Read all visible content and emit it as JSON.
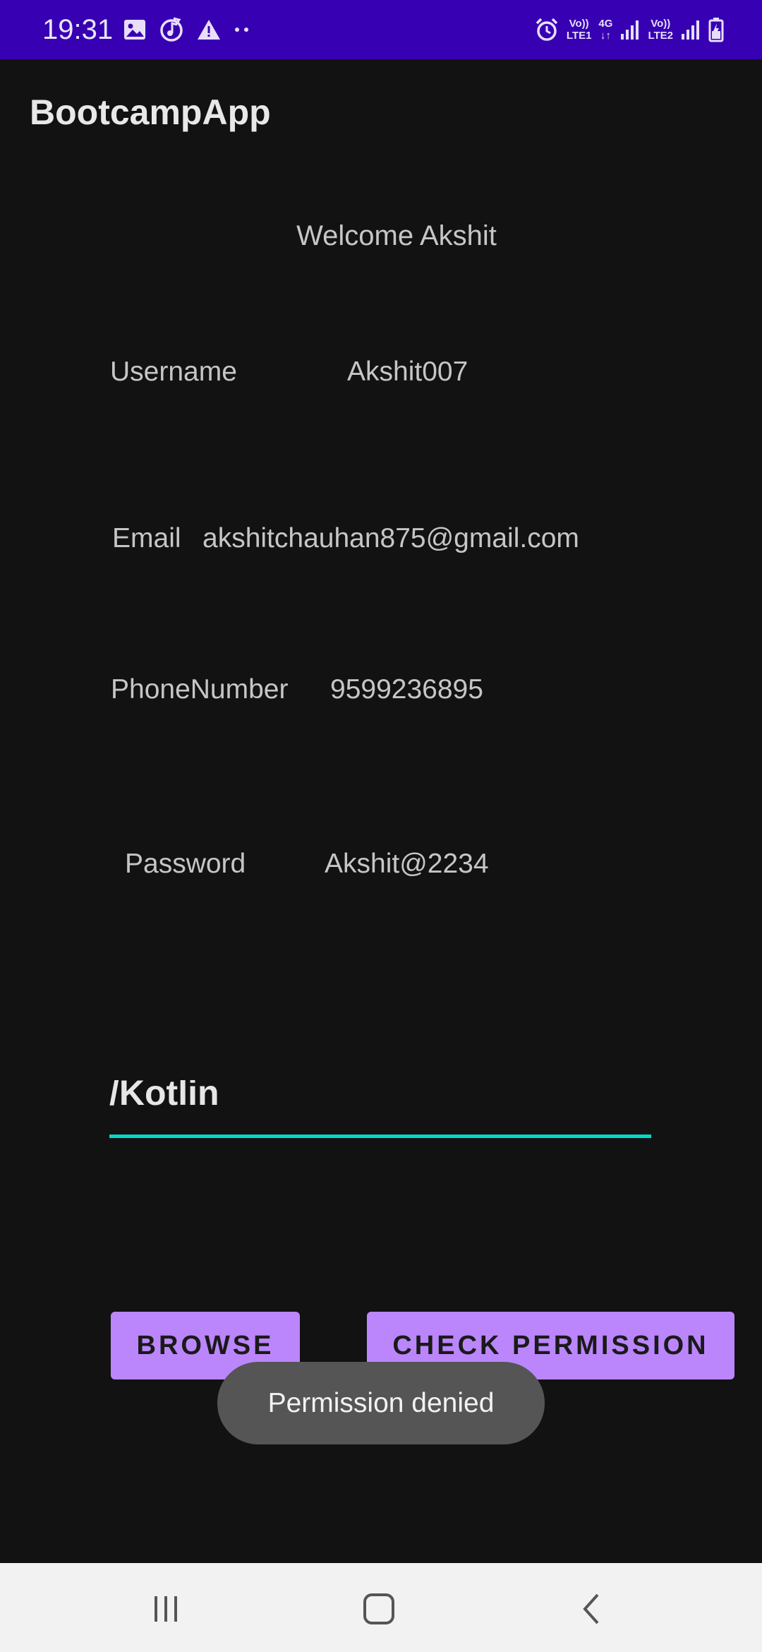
{
  "status_bar": {
    "time": "19:31",
    "left_icons": [
      "image-icon",
      "music-sync-icon",
      "warning-icon",
      "more-dots-icon"
    ],
    "sim1": {
      "top": "Vo))",
      "bottom": "LTE1"
    },
    "network": "4G",
    "sim2": {
      "top": "Vo))",
      "bottom": "LTE2"
    },
    "right_icons": [
      "alarm-icon",
      "signal-icon",
      "battery-charging-icon"
    ],
    "color": "#3700b3"
  },
  "app_bar": {
    "title": "BootcampApp"
  },
  "welcome": "Welcome Akshit",
  "fields": {
    "username": {
      "label": "Username",
      "value": "Akshit007"
    },
    "email": {
      "label": "Email",
      "value": "akshitchauhan875@gmail.com"
    },
    "phone": {
      "label": "PhoneNumber",
      "value": "9599236895"
    },
    "password": {
      "label": "Password",
      "value": "Akshit@2234"
    }
  },
  "edit_field": {
    "text": "/Kotlin",
    "accent": "#03dac5"
  },
  "buttons": {
    "browse": "BROWSE",
    "check_permission": "CHECK PERMISSION",
    "color": "#bb86fc"
  },
  "toast": {
    "text": "Permission denied"
  },
  "nav_bar": {
    "icons": [
      "recent-apps-icon",
      "home-icon",
      "back-icon"
    ]
  }
}
